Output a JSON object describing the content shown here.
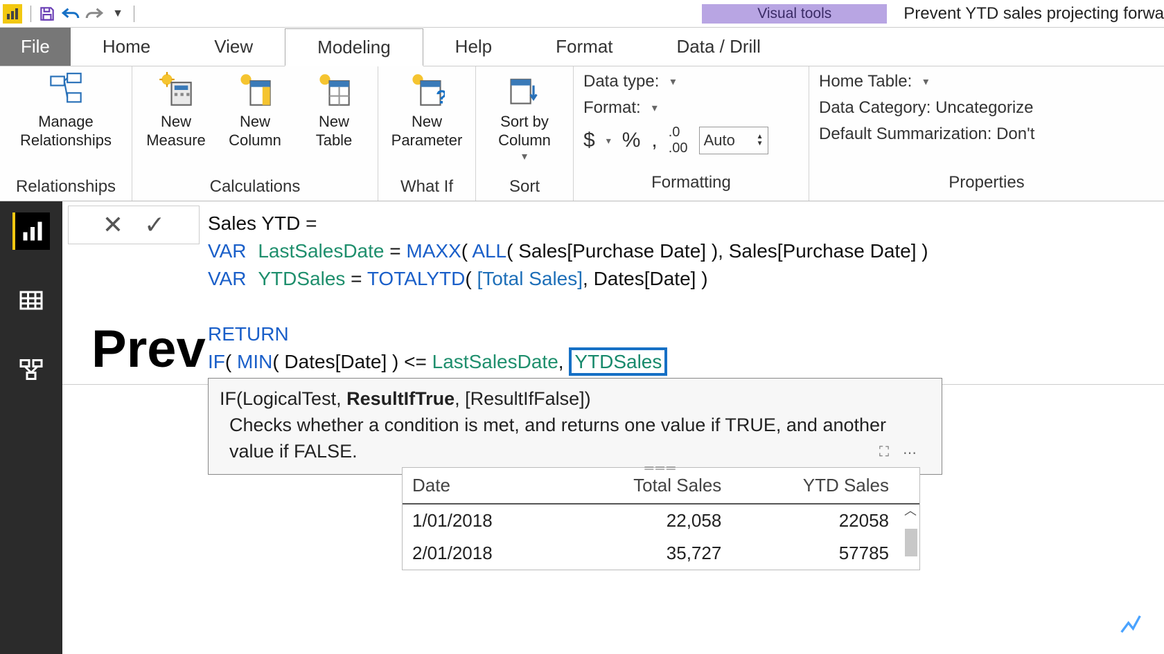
{
  "title_bar": {
    "tool_tab": "Visual tools",
    "doc_title": "Prevent YTD sales projecting forwa"
  },
  "tabs": {
    "file": "File",
    "home": "Home",
    "view": "View",
    "modeling": "Modeling",
    "help": "Help",
    "format": "Format",
    "data_drill": "Data / Drill"
  },
  "ribbon": {
    "relationships": {
      "manage": "Manage\nRelationships",
      "group": "Relationships"
    },
    "calculations": {
      "measure": "New\nMeasure",
      "column": "New\nColumn",
      "table": "New\nTable",
      "group": "Calculations"
    },
    "whatif": {
      "param": "New\nParameter",
      "group": "What If"
    },
    "sort": {
      "sortby": "Sort by\nColumn",
      "group": "Sort"
    },
    "formatting": {
      "datatype_label": "Data type:",
      "format_label": "Format:",
      "currency": "$",
      "percent": "%",
      "comma": ",",
      "auto": "Auto",
      "group": "Formatting"
    },
    "properties": {
      "home_table": "Home Table:",
      "data_category": "Data Category: Uncategorize",
      "default_summ": "Default Summarization: Don't",
      "group": "Properties"
    }
  },
  "formula": {
    "line1_a": "Sales YTD =",
    "line2": {
      "var": "VAR",
      "name": "LastSalesDate",
      "eq": " = ",
      "fn": "MAXX",
      "open": "( ",
      "all": "ALL",
      "arg1": "( Sales[Purchase Date] ), Sales[Purchase Date] )"
    },
    "line3": {
      "var": "VAR",
      "name": "YTDSales",
      "eq": " = ",
      "fn": "TOTALYTD",
      "open": "( ",
      "id": "[Total Sales]",
      "rest": ", Dates[Date] )"
    },
    "line5": "RETURN",
    "line6": {
      "if": "IF",
      "open": "( ",
      "min": "MIN",
      "arg": "( Dates[Date] ) <= ",
      "v1": "LastSalesDate",
      "comma": ", ",
      "v2": "YTDSales"
    }
  },
  "tooltip": {
    "sig_prefix": "IF(LogicalTest, ",
    "sig_bold": "ResultIfTrue",
    "sig_suffix": ", [ResultIfFalse])",
    "desc": "Checks whether a condition is met, and returns one value if TRUE, and another value if FALSE."
  },
  "page_title": "Prev",
  "table": {
    "headers": {
      "date": "Date",
      "total": "Total Sales",
      "ytd": "YTD Sales"
    },
    "rows": [
      {
        "date": "1/01/2018",
        "total": "22,058",
        "ytd": "22058"
      },
      {
        "date": "2/01/2018",
        "total": "35,727",
        "ytd": "57785"
      }
    ]
  }
}
